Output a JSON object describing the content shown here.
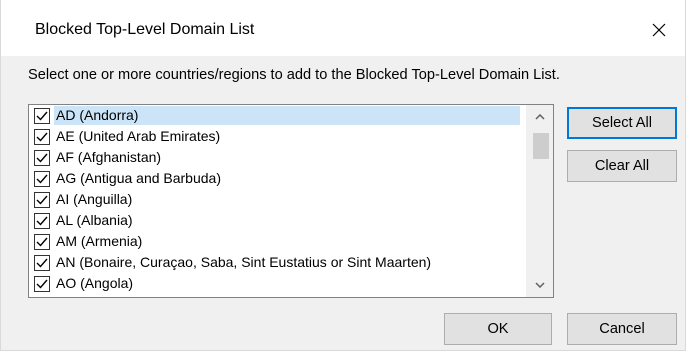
{
  "dialog": {
    "title": "Blocked Top-Level Domain List",
    "instruction": "Select one or more countries/regions to add to the Blocked Top-Level Domain List."
  },
  "list": {
    "items": [
      {
        "label": "AD (Andorra)",
        "checked": true,
        "selected": true
      },
      {
        "label": "AE (United Arab Emirates)",
        "checked": true,
        "selected": false
      },
      {
        "label": "AF (Afghanistan)",
        "checked": true,
        "selected": false
      },
      {
        "label": "AG (Antigua and Barbuda)",
        "checked": true,
        "selected": false
      },
      {
        "label": "AI (Anguilla)",
        "checked": true,
        "selected": false
      },
      {
        "label": "AL (Albania)",
        "checked": true,
        "selected": false
      },
      {
        "label": "AM (Armenia)",
        "checked": true,
        "selected": false
      },
      {
        "label": "AN (Bonaire, Curaçao, Saba, Sint Eustatius or Sint Maarten)",
        "checked": true,
        "selected": false
      },
      {
        "label": "AO (Angola)",
        "checked": true,
        "selected": false
      }
    ]
  },
  "buttons": {
    "select_all": "Select All",
    "clear_all": "Clear All",
    "ok": "OK",
    "cancel": "Cancel"
  },
  "icons": {
    "close": "close-icon",
    "scroll_up": "chevron-up-icon",
    "scroll_down": "chevron-down-icon",
    "check": "checkmark-icon"
  },
  "colors": {
    "selection": "#cce4f7",
    "default_button_border": "#0078d7",
    "button_face": "#e1e1e1",
    "dialog_background": "#f0f0f0"
  }
}
